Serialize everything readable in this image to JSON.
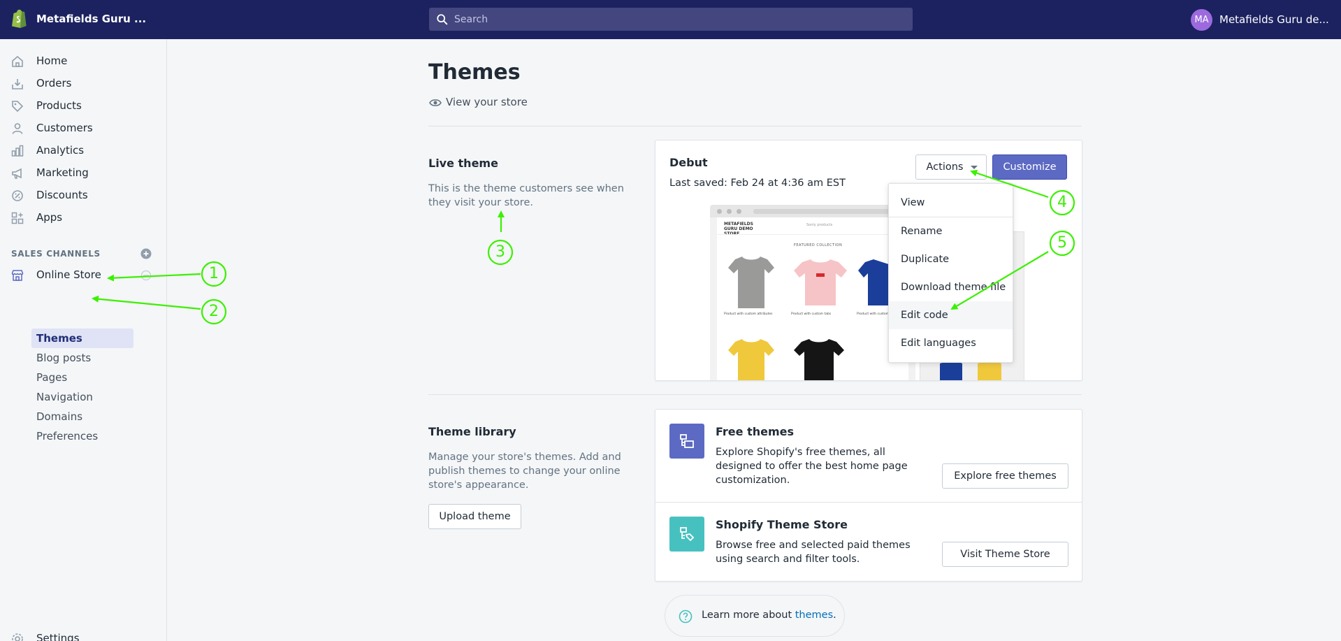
{
  "topbar": {
    "store_name": "Metafields Guru ...",
    "search_placeholder": "Search",
    "avatar_initials": "MA",
    "user_name": "Metafields Guru de..."
  },
  "sidebar": {
    "items": [
      {
        "label": "Home",
        "icon": "home-icon"
      },
      {
        "label": "Orders",
        "icon": "orders-icon"
      },
      {
        "label": "Products",
        "icon": "tag-icon"
      },
      {
        "label": "Customers",
        "icon": "person-icon"
      },
      {
        "label": "Analytics",
        "icon": "bar-chart-icon"
      },
      {
        "label": "Marketing",
        "icon": "megaphone-icon"
      },
      {
        "label": "Discounts",
        "icon": "discount-icon"
      },
      {
        "label": "Apps",
        "icon": "apps-icon"
      }
    ],
    "sales_channels_heading": "SALES CHANNELS",
    "online_store_label": "Online Store",
    "sub_items": [
      "Themes",
      "Blog posts",
      "Pages",
      "Navigation",
      "Domains",
      "Preferences"
    ],
    "active_sub_item": "Themes",
    "settings_label": "Settings"
  },
  "main": {
    "title": "Themes",
    "view_store": "View your store",
    "live_theme": {
      "heading": "Live theme",
      "description": "This is the theme customers see when they visit your store.",
      "theme_name": "Debut",
      "last_saved": "Last saved: Feb 24 at 4:36 am EST",
      "actions_label": "Actions",
      "customize_label": "Customize",
      "preview": {
        "store_name": "METAFIELDS GURU DEMO STORE",
        "nav": "Sonly products",
        "featured": "FEATURED COLLECTION",
        "captions": [
          "Product with custom attributes",
          "Product with custom tabs",
          "Product with custom..."
        ]
      }
    },
    "actions_menu": [
      "View",
      "Rename",
      "Duplicate",
      "Download theme file",
      "Edit code",
      "Edit languages"
    ],
    "actions_menu_hovered": "Edit code",
    "library": {
      "heading": "Theme library",
      "description": "Manage your store's themes. Add and publish themes to change your online store's appearance.",
      "upload_label": "Upload theme",
      "free": {
        "title": "Free themes",
        "description": "Explore Shopify's free themes, all designed to offer the best home page customization.",
        "button": "Explore free themes"
      },
      "store": {
        "title": "Shopify Theme Store",
        "description": "Browse free and selected paid themes using search and filter tools.",
        "button": "Visit Theme Store"
      }
    },
    "learn_more": {
      "prefix": "Learn more about ",
      "link": "themes",
      "suffix": "."
    }
  },
  "annotations": {
    "labels": [
      "1",
      "2",
      "3",
      "4",
      "5"
    ],
    "color": "#3cf000"
  },
  "colors": {
    "topbar": "#1c2260",
    "primary": "#5c6ac4",
    "free_theme_icon": "#5c6ac4",
    "theme_store_icon": "#47c1bf",
    "link": "#006fbb"
  }
}
